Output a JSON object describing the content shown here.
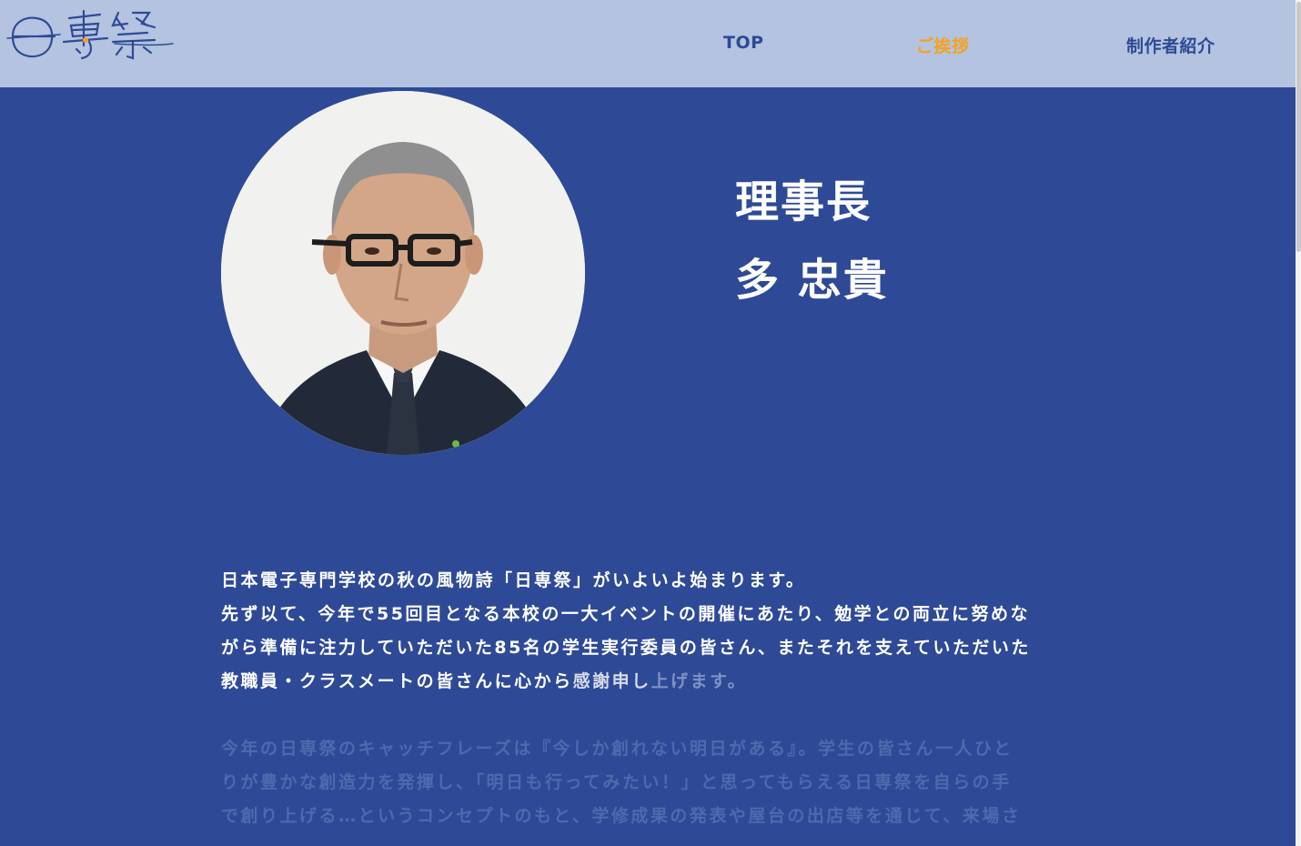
{
  "header": {
    "logo_alt": "日専祭",
    "nav": [
      {
        "label": "TOP"
      },
      {
        "label": "ご挨拶"
      },
      {
        "label": "制作者紹介"
      }
    ]
  },
  "profile": {
    "role": "理事長",
    "name": "多 忠貴"
  },
  "message": {
    "paragraph1": [
      "日本電子専門学校の秋の風物詩「日専祭」がいよいよ始まります。",
      "先ず以て、今年で55回目となる本校の一大イベントの開催にあたり、勉学との両立に努めな",
      "がら準備に注力していただいた85名の学生実行委員の皆さん、またそれを支えていただいた"
    ],
    "line4_main": "教職員・クラスメートの皆さんに心から",
    "line4_fade_a": "感謝申し",
    "line4_fade_b": "上げます。",
    "paragraph2": [
      "今年の日専祭のキャッチフレーズは『今しか創れない明日がある』。学生の皆さん一人ひと",
      "りが豊かな創造力を発揮し、「明日も行ってみたい！」と思ってもらえる日専祭を自らの手",
      "で創り上げる…というコンセプトのもと、学修成果の発表や屋台の出店等を通じて、来場さ"
    ]
  },
  "colors": {
    "header_bg": "#b3c3e0",
    "main_bg": "#2e4a96",
    "nav_text": "#2e4a96",
    "nav_active": "#f5a21c",
    "text": "#ffffff"
  }
}
